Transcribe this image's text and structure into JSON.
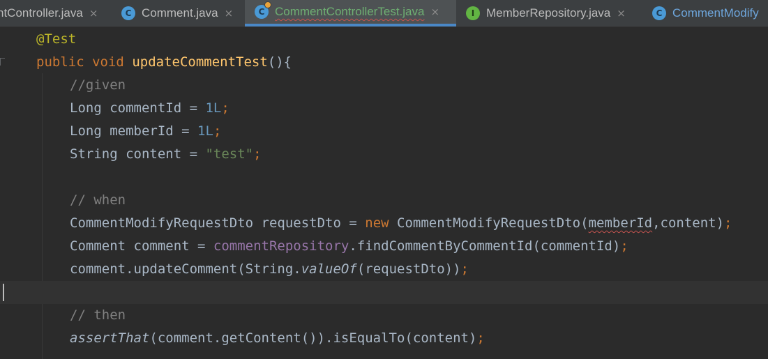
{
  "tabs": [
    {
      "label": "ntController.java",
      "icon": "none",
      "close": "×"
    },
    {
      "label": "Comment.java",
      "icon": "class-icon",
      "close": "×"
    },
    {
      "label": "CommentControllerTest.java",
      "icon": "test-class-icon",
      "close": "×"
    },
    {
      "label": "MemberRepository.java",
      "icon": "interface-icon",
      "close": "×"
    },
    {
      "label": "CommentModify",
      "icon": "class-icon",
      "close": ""
    }
  ],
  "tab_icon_letters": {
    "class": "C",
    "interface": "I"
  },
  "editor": {
    "annotation": "@Test",
    "sig": {
      "public": "public",
      "void": "void",
      "method": "updateCommentTest",
      "rest": "(){"
    },
    "comment_given": "//given",
    "line_commentId": {
      "type": "Long",
      "mid": " commentId = ",
      "num": "1L",
      "semi": ";"
    },
    "line_memberId": {
      "type": "Long",
      "mid": " memberId = ",
      "num": "1L",
      "semi": ";"
    },
    "line_content": {
      "head": "String content = ",
      "str": "\"test\"",
      "semi": ";"
    },
    "comment_when": "// when",
    "line_dto": {
      "head": "CommentModifyRequestDto requestDto = ",
      "new": "new",
      "mid": " CommentModifyRequestDto(",
      "arg1": "memberId",
      "rest": ",content)",
      "semi": ";"
    },
    "line_find": {
      "head": "Comment comment = ",
      "field": "commentRepository",
      "rest": ".findCommentByCommentId(commentId)",
      "semi": ";"
    },
    "line_update": {
      "head": "comment.updateComment(String.",
      "italic": "valueOf",
      "rest": "(requestDto))",
      "semi": ";"
    },
    "comment_then": "// then",
    "line_assert": {
      "italic": "assertThat",
      "rest": "(comment.getContent()).isEqualTo(content)",
      "semi": ";"
    }
  },
  "colors": {
    "background": "#2b2b2b",
    "keyword": "#cc7832",
    "method": "#ffc66d",
    "comment": "#808080",
    "number": "#6897bb",
    "string": "#6a8759",
    "field": "#9876aa",
    "active_tab_accent": "#4a88c7"
  }
}
